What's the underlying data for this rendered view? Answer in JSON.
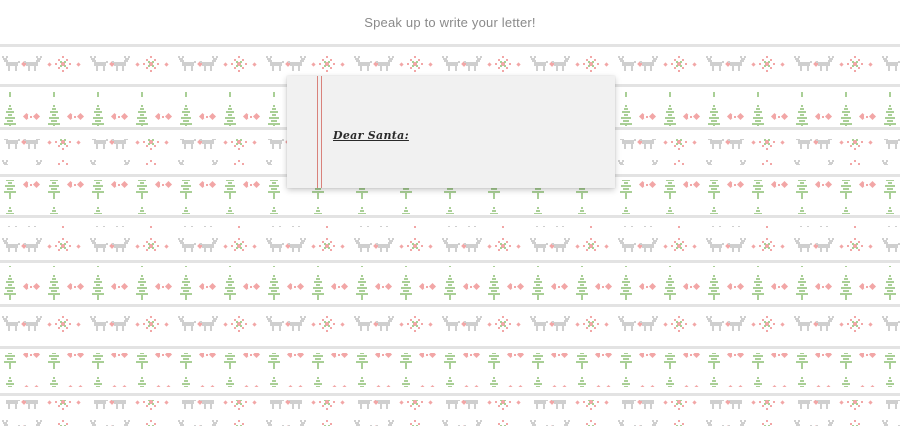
{
  "header": {
    "prompt": "Speak up to write your letter!"
  },
  "letter": {
    "greeting": "Dear Santa:"
  },
  "colors": {
    "background": "#ffffff",
    "divider": "#e3e3e3",
    "reindeer": "#cfcfcf",
    "pink": "#f2a6a6",
    "green": "#a9cf96",
    "paper": "#f1f1f1",
    "margin_line": "#d9827b"
  }
}
